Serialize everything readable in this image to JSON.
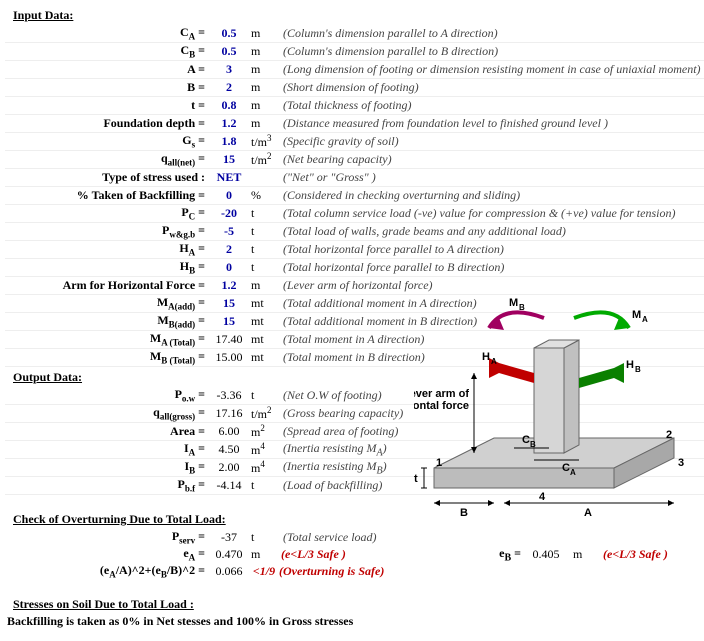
{
  "header_input": "Input Data:",
  "inputs": [
    {
      "label": "C<sub>A</sub> =",
      "value": "0.5",
      "unit": "m",
      "desc": "(Column's dimension parallel to A direction)"
    },
    {
      "label": "C<sub>B</sub> =",
      "value": "0.5",
      "unit": "m",
      "desc": "(Column's dimension parallel to B direction)"
    },
    {
      "label": "A =",
      "value": "3",
      "unit": "m",
      "desc": "(Long dimension of footing or dimension resisting moment in case of uniaxial moment)"
    },
    {
      "label": "B =",
      "value": "2",
      "unit": "m",
      "desc": "(Short dimension of footing)"
    },
    {
      "label": "t =",
      "value": "0.8",
      "unit": "m",
      "desc": "(Total thickness of footing)"
    },
    {
      "label": "Foundation depth =",
      "value": "1.2",
      "unit": "m",
      "desc": "(Distance measured from foundation level to finished ground level )"
    },
    {
      "label": "G<sub>s</sub> =",
      "value": "1.8",
      "unit": "t/m<sup>3</sup>",
      "desc": "(Specific gravity of soil)"
    },
    {
      "label": "q<sub>all(net)</sub> =",
      "value": "15",
      "unit": "t/m<sup>2</sup>",
      "desc": "(Net bearing capacity)"
    },
    {
      "label": "Type of stress used :",
      "value": "NET",
      "unit": "",
      "desc": "(\"Net\" or \"Gross\" )"
    },
    {
      "label": "% Taken of Backfilling =",
      "value": "0",
      "unit": "%",
      "desc": "(Considered in checking overturning and sliding)"
    },
    {
      "label": "P<sub>C</sub> =",
      "value": "-20",
      "unit": "t",
      "desc": "(Total column service load (-ve) value for compression & (+ve) value for tension)"
    },
    {
      "label": "P<sub>w&g.b</sub> =",
      "value": "-5",
      "unit": "t",
      "desc": "(Total load of walls, grade beams and any additional load)"
    },
    {
      "label": "H<sub>A</sub> =",
      "value": "2",
      "unit": "t",
      "desc": "(Total horizontal force parallel to A direction)"
    },
    {
      "label": "H<sub>B</sub> =",
      "value": "0",
      "unit": "t",
      "desc": "(Total horizontal force parallel to B direction)"
    },
    {
      "label": "Arm for Horizontal Force =",
      "value": "1.2",
      "unit": "m",
      "desc": "(Lever arm of horizontal force)"
    },
    {
      "label": "M<sub>A(add)</sub> =",
      "value": "15",
      "unit": "mt",
      "desc": "(Total additional moment in A direction)"
    },
    {
      "label": "M<sub>B(add)</sub> =",
      "value": "15",
      "unit": "mt",
      "desc": "(Total additional moment in B direction)"
    },
    {
      "label": "M<sub>A (Total)</sub> =",
      "value": "17.40",
      "unit": "mt",
      "desc": "(Total moment in A direction)",
      "out": true
    },
    {
      "label": "M<sub>B (Total)</sub> =",
      "value": "15.00",
      "unit": "mt",
      "desc": "(Total moment in B direction)",
      "out": true
    }
  ],
  "header_output": "Output Data:",
  "outputs": [
    {
      "label": "P<sub>o.w</sub> =",
      "value": "-3.36",
      "unit": "t",
      "desc": "(Net O.W of footing)"
    },
    {
      "label": "q<sub>all(gross)</sub> =",
      "value": "17.16",
      "unit": "t/m<sup>2</sup>",
      "desc": "(Gross bearing capacity)"
    },
    {
      "label": "Area =",
      "value": "6.00",
      "unit": "m<sup>2</sup>",
      "desc": "(Spread area of footing)"
    },
    {
      "label": "I<sub>A</sub> =",
      "value": "4.50",
      "unit": "m<sup>4</sup>",
      "desc": "(Inertia resisting M<sub>A</sub>)"
    },
    {
      "label": "I<sub>B</sub> =",
      "value": "2.00",
      "unit": "m<sup>4</sup>",
      "desc": "(Inertia resisting M<sub>B</sub>)"
    },
    {
      "label": "P<sub>b.f</sub> =",
      "value": "-4.14",
      "unit": "t",
      "desc": "(Load of backfilling)"
    }
  ],
  "check_over_title": "Check of Overturning Due to Total Load:",
  "pserv": {
    "label": "P<sub>serv</sub> =",
    "value": "-37",
    "unit": "t",
    "desc": "(Total service load)"
  },
  "ea": {
    "label": "e<sub>A</sub> =",
    "value": "0.470",
    "unit": "m",
    "safe": "(e<L/3 Safe )"
  },
  "eb": {
    "label": "e<sub>B</sub> =",
    "value": "0.405",
    "unit": "m",
    "safe": "(e<L/3 Safe )"
  },
  "overt": {
    "label": "(e<sub>A</sub>/A)^2+(e<sub>B</sub>/B)^2 =",
    "value": "0.066",
    "limit": "<1/9",
    "safe": "(Overturning is Safe)"
  },
  "stresses_title": "Stresses on Soil Due to Total Load :",
  "backfill_note": "Backfilling is taken as 0% in Net stesses and 100% in Gross stresses",
  "diagram": {
    "lever": "Lever arm of horizontal force",
    "MA": "M",
    "MAs": "A",
    "MB": "M",
    "MBs": "B",
    "HA": "H",
    "HAs": "A",
    "HB": "H",
    "HBs": "B",
    "CA": "C",
    "CAs": "A",
    "CB": "C",
    "CBs": "B",
    "A": "A",
    "B": "B",
    "t": "t",
    "n1": "1",
    "n2": "2",
    "n3": "3",
    "n4": "4"
  }
}
